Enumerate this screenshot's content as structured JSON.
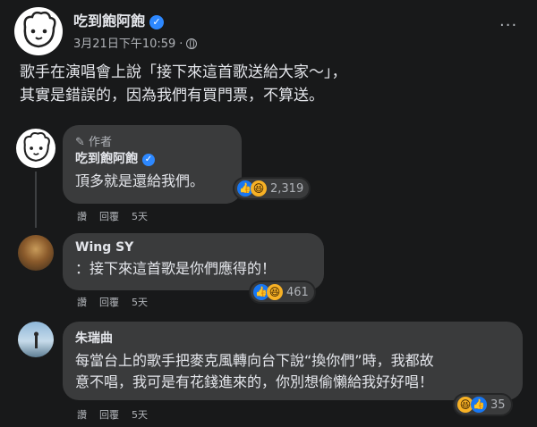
{
  "post": {
    "page_name": "吃到飽阿飽",
    "timestamp": "3月21日下午10:59",
    "separator": "·",
    "text_line1": "歌手在演唱會上說「接下來這首歌送給大家～」，",
    "text_line2": "其實是錯誤的，因為我們有買門票，不算送。"
  },
  "comments": [
    {
      "author_tag": "作者",
      "name": "吃到飽阿飽",
      "text": "頂多就是還給我們。",
      "reaction_count": "2,319",
      "actions": {
        "like": "讚",
        "reply": "回覆",
        "time": "5天"
      }
    },
    {
      "name": "Wing SY",
      "text": "：接下來這首歌是你們應得的！",
      "reaction_count": "461",
      "actions": {
        "like": "讚",
        "reply": "回覆",
        "time": "5天"
      }
    },
    {
      "name": "朱瑞曲",
      "text_line1": "每當台上的歌手把麥克風轉向台下說“換你們”時，我都故",
      "text_line2": "意不唱，我可是有花錢進來的，你別想偷懶給我好好唱！",
      "reaction_count": "35",
      "actions": {
        "like": "讚",
        "reply": "回覆",
        "time": "5天"
      }
    }
  ],
  "colors": {
    "background": "#18191a",
    "bubble": "#3a3b3c",
    "text": "#e4e6eb",
    "secondary_text": "#b0b3b8",
    "verified_blue": "#2d88ff",
    "like_blue": "#1877f2",
    "haha_yellow": "#f7b125"
  }
}
